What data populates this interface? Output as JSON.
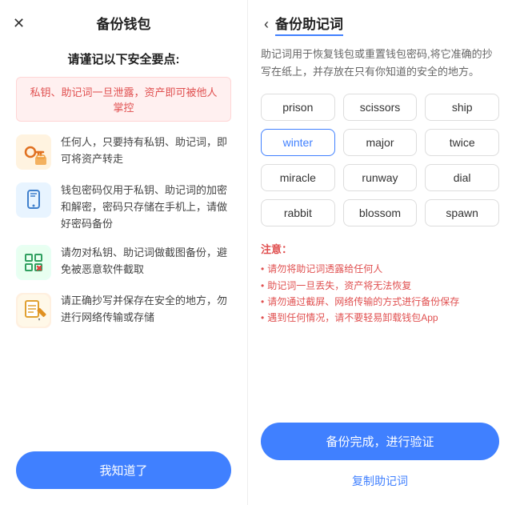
{
  "left": {
    "close_icon": "✕",
    "title": "备份钱包",
    "subtitle": "请谨记以下安全要点:",
    "warning": "私钥、助记词一旦泄露，资产即可被他人掌控",
    "items": [
      {
        "icon": "🔑",
        "icon_bg": "key",
        "text": "任何人，只要持有私钥、助记词，即可将资产转走"
      },
      {
        "icon": "📱",
        "icon_bg": "phone",
        "text": "钱包密码仅用于私钥、助记词的加密和解密，密码只存储在手机上，请做好密码备份"
      },
      {
        "icon": "📷",
        "icon_bg": "scan",
        "text": "请勿对私钥、助记词做截图备份，避免被恶意软件截取"
      },
      {
        "icon": "📝",
        "icon_bg": "write",
        "text": "请正确抄写并保存在安全的地方，勿进行网络传输或存储"
      }
    ],
    "button": "我知道了"
  },
  "right": {
    "back_icon": "‹",
    "title": "备份助记词",
    "desc": "助记词用于恢复钱包或重置钱包密码,将它准确的抄写在纸上，并存放在只有你知道的安全的地方。",
    "words": [
      {
        "word": "prison",
        "highlighted": false
      },
      {
        "word": "scissors",
        "highlighted": false
      },
      {
        "word": "ship",
        "highlighted": false
      },
      {
        "word": "winter",
        "highlighted": true
      },
      {
        "word": "major",
        "highlighted": false
      },
      {
        "word": "twice",
        "highlighted": false
      },
      {
        "word": "miracle",
        "highlighted": false
      },
      {
        "word": "runway",
        "highlighted": false
      },
      {
        "word": "dial",
        "highlighted": false
      },
      {
        "word": "rabbit",
        "highlighted": false
      },
      {
        "word": "blossom",
        "highlighted": false
      },
      {
        "word": "spawn",
        "highlighted": false
      }
    ],
    "notice_title": "注意：",
    "notices": [
      "请勿将助记词透露给任何人",
      "助记词一旦丢失，资产将无法恢复",
      "请勿通过截屏、网络传输的方式进行备份保存",
      "遇到任何情况，请不要轻易卸载钱包App"
    ],
    "verify_button": "备份完成，进行验证",
    "copy_button": "复制助记词"
  }
}
